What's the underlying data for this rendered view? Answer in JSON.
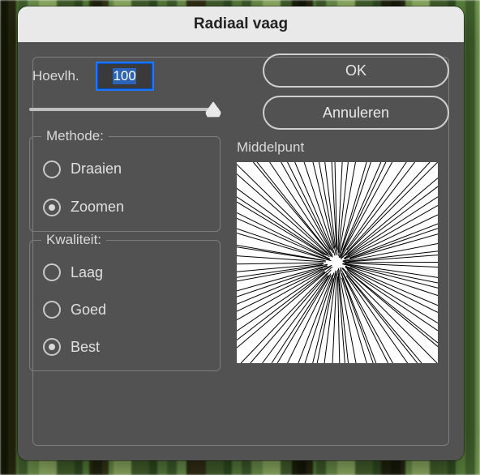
{
  "dialog": {
    "title": "Radiaal vaag",
    "amount_label": "Hoevlh.",
    "amount_value": "100",
    "center_label": "Middelpunt"
  },
  "buttons": {
    "ok": "OK",
    "cancel": "Annuleren"
  },
  "method": {
    "legend": "Methode:",
    "options": [
      {
        "key": "spin",
        "label": "Draaien",
        "selected": false
      },
      {
        "key": "zoom",
        "label": "Zoomen",
        "selected": true
      }
    ]
  },
  "quality": {
    "legend": "Kwaliteit:",
    "options": [
      {
        "key": "low",
        "label": "Laag",
        "selected": false
      },
      {
        "key": "good",
        "label": "Goed",
        "selected": false
      },
      {
        "key": "best",
        "label": "Best",
        "selected": true
      }
    ]
  },
  "colors": {
    "panel_bg": "#525252",
    "focus_ring": "#1d78ff"
  }
}
